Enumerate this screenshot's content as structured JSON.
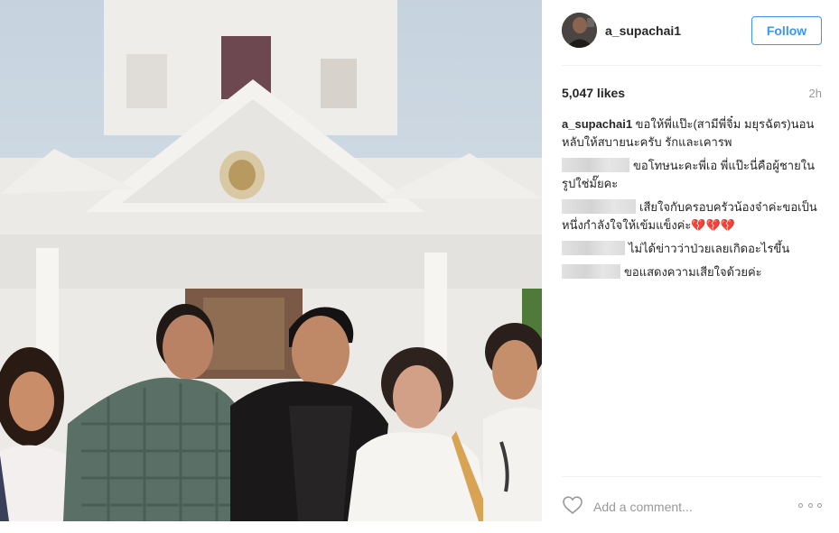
{
  "post": {
    "username": "a_supachai1",
    "follow_label": "Follow",
    "likes": "5,047 likes",
    "time": "2h",
    "photo_alt": "Group photo of five people in front of a white Thai temple"
  },
  "comments": [
    {
      "author": "a_supachai1",
      "text": "ขอให้พี่แป๊ะ(สามีพี่จิ๋ม มยุรฉัตร)นอนหลับให้สบายนะครับ รักและเคารพ",
      "author_hidden": false
    },
    {
      "author": "",
      "text": "ขอโทษนะคะพี่เอ พี่แป๊ะนี่คือผู้ชายในรูปใช่มั๊ยคะ",
      "author_hidden": true
    },
    {
      "author": "",
      "text": "เสียใจกับครอบครัวน้องจ๋าค่ะขอเป็นหนึ่งกำลังใจให้เข้มแข็งค่ะ💔💔💔",
      "author_hidden": true
    },
    {
      "author": "",
      "text": "ไม่ได้ข่าวว่าป่วยเลยเกิดอะไรขึ้น",
      "author_hidden": true
    },
    {
      "author": "",
      "text": "ขอแสดงความเสียใจด้วยค่ะ",
      "author_hidden": true
    }
  ],
  "footer": {
    "comment_placeholder": "Add a comment...",
    "like_icon": "heart-outline-icon",
    "more_icon": "more-options-icon"
  },
  "colors": {
    "accent": "#3897f0",
    "muted": "#999999",
    "divider": "#efefef"
  }
}
